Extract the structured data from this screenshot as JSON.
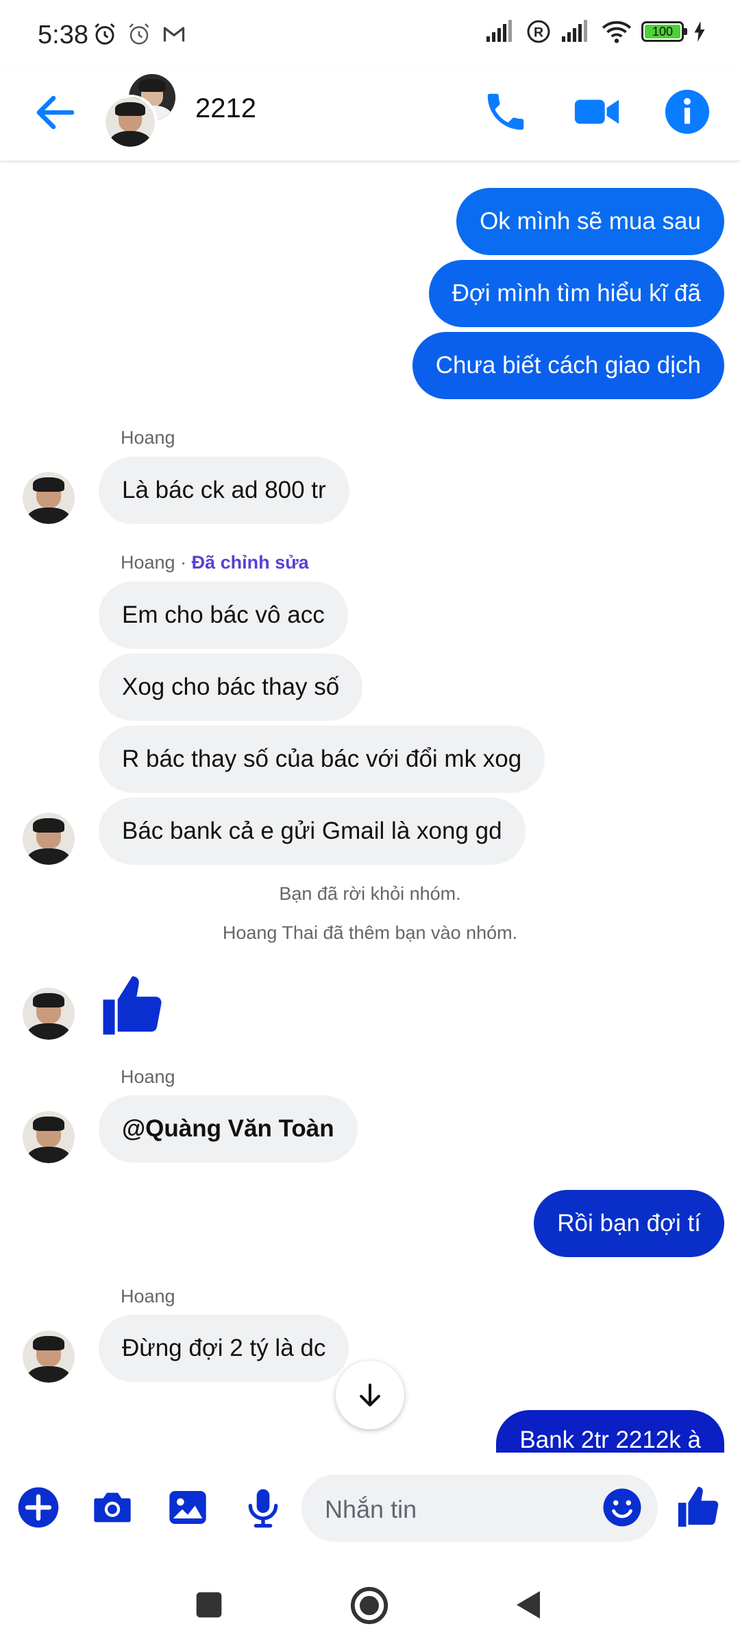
{
  "status_bar": {
    "time": "5:38",
    "battery": "100"
  },
  "header": {
    "title": "2212",
    "back_icon": "arrow-left-icon",
    "call_icon": "phone-icon",
    "video_icon": "video-camera-icon",
    "info_icon": "info-icon"
  },
  "messages": {
    "out1": "Ok mình sẽ mua sau",
    "out2": "Đợi mình tìm hiểu kĩ đã",
    "out3": "Chưa biết cách giao dịch",
    "sender1": "Hoang",
    "in1": "Là bác ck ad 800 tr",
    "sender2": "Hoang",
    "sender2_sep": " · ",
    "sender2_edited": "Đã chỉnh sửa",
    "in2": "Em cho bác vô acc",
    "in3": "Xog cho bác thay số",
    "in4": "R bác thay số của bác với đổi mk xog",
    "in5": "Bác bank cả e gửi Gmail là xong gd",
    "sys1": "Bạn đã rời khỏi nhóm.",
    "sys2": "Hoang Thai đã thêm bạn vào nhóm.",
    "sender3": "Hoang",
    "in6": "@Quàng Văn Toàn",
    "out4": "Rồi bạn đợi tí",
    "sender4": "Hoang",
    "in7": "Đừng đợi 2 tý là dc",
    "out5": "Bank 2tr 2212k à"
  },
  "composer": {
    "placeholder": "Nhắn tin"
  },
  "colors": {
    "accent": "#0a7cff",
    "bubble_out": "#0a5ce6",
    "bubble_out_dark": "#0a1fc4",
    "bubble_in": "#f0f1f3",
    "icon_blue": "#0866ff",
    "like_blue": "#0a2fd1"
  }
}
